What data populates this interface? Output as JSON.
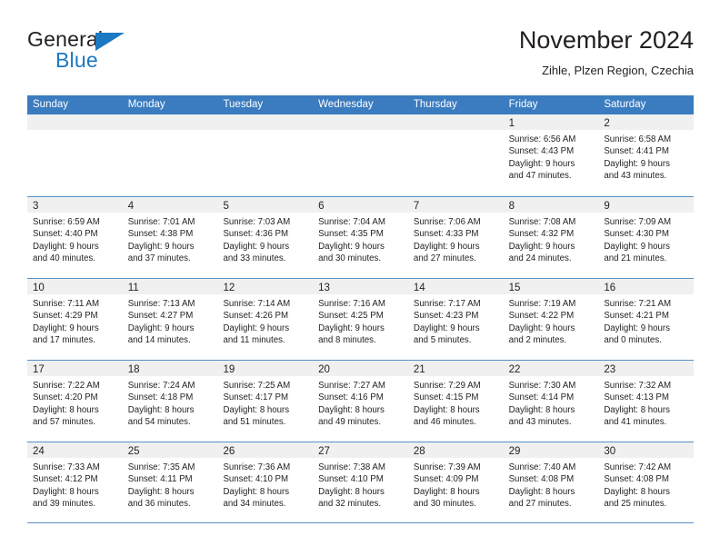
{
  "brand": {
    "name_part1": "General",
    "name_part2": "Blue",
    "flag_icon": "triangle-flag-icon",
    "accent_color": "#1b79c1"
  },
  "header": {
    "title": "November 2024",
    "subtitle": "Zihle, Plzen Region, Czechia"
  },
  "theme": {
    "header_blue": "#3b7cc0",
    "row_line": "#5b90c8",
    "day_band": "#f0f0f0",
    "text": "#231f20"
  },
  "calendar": {
    "weekdays": [
      "Sunday",
      "Monday",
      "Tuesday",
      "Wednesday",
      "Thursday",
      "Friday",
      "Saturday"
    ],
    "weeks": [
      [
        {
          "day": "",
          "empty": true
        },
        {
          "day": "",
          "empty": true
        },
        {
          "day": "",
          "empty": true
        },
        {
          "day": "",
          "empty": true
        },
        {
          "day": "",
          "empty": true
        },
        {
          "day": "1",
          "sunrise": "Sunrise: 6:56 AM",
          "sunset": "Sunset: 4:43 PM",
          "daylight1": "Daylight: 9 hours",
          "daylight2": "and 47 minutes."
        },
        {
          "day": "2",
          "sunrise": "Sunrise: 6:58 AM",
          "sunset": "Sunset: 4:41 PM",
          "daylight1": "Daylight: 9 hours",
          "daylight2": "and 43 minutes."
        }
      ],
      [
        {
          "day": "3",
          "sunrise": "Sunrise: 6:59 AM",
          "sunset": "Sunset: 4:40 PM",
          "daylight1": "Daylight: 9 hours",
          "daylight2": "and 40 minutes."
        },
        {
          "day": "4",
          "sunrise": "Sunrise: 7:01 AM",
          "sunset": "Sunset: 4:38 PM",
          "daylight1": "Daylight: 9 hours",
          "daylight2": "and 37 minutes."
        },
        {
          "day": "5",
          "sunrise": "Sunrise: 7:03 AM",
          "sunset": "Sunset: 4:36 PM",
          "daylight1": "Daylight: 9 hours",
          "daylight2": "and 33 minutes."
        },
        {
          "day": "6",
          "sunrise": "Sunrise: 7:04 AM",
          "sunset": "Sunset: 4:35 PM",
          "daylight1": "Daylight: 9 hours",
          "daylight2": "and 30 minutes."
        },
        {
          "day": "7",
          "sunrise": "Sunrise: 7:06 AM",
          "sunset": "Sunset: 4:33 PM",
          "daylight1": "Daylight: 9 hours",
          "daylight2": "and 27 minutes."
        },
        {
          "day": "8",
          "sunrise": "Sunrise: 7:08 AM",
          "sunset": "Sunset: 4:32 PM",
          "daylight1": "Daylight: 9 hours",
          "daylight2": "and 24 minutes."
        },
        {
          "day": "9",
          "sunrise": "Sunrise: 7:09 AM",
          "sunset": "Sunset: 4:30 PM",
          "daylight1": "Daylight: 9 hours",
          "daylight2": "and 21 minutes."
        }
      ],
      [
        {
          "day": "10",
          "sunrise": "Sunrise: 7:11 AM",
          "sunset": "Sunset: 4:29 PM",
          "daylight1": "Daylight: 9 hours",
          "daylight2": "and 17 minutes."
        },
        {
          "day": "11",
          "sunrise": "Sunrise: 7:13 AM",
          "sunset": "Sunset: 4:27 PM",
          "daylight1": "Daylight: 9 hours",
          "daylight2": "and 14 minutes."
        },
        {
          "day": "12",
          "sunrise": "Sunrise: 7:14 AM",
          "sunset": "Sunset: 4:26 PM",
          "daylight1": "Daylight: 9 hours",
          "daylight2": "and 11 minutes."
        },
        {
          "day": "13",
          "sunrise": "Sunrise: 7:16 AM",
          "sunset": "Sunset: 4:25 PM",
          "daylight1": "Daylight: 9 hours",
          "daylight2": "and 8 minutes."
        },
        {
          "day": "14",
          "sunrise": "Sunrise: 7:17 AM",
          "sunset": "Sunset: 4:23 PM",
          "daylight1": "Daylight: 9 hours",
          "daylight2": "and 5 minutes."
        },
        {
          "day": "15",
          "sunrise": "Sunrise: 7:19 AM",
          "sunset": "Sunset: 4:22 PM",
          "daylight1": "Daylight: 9 hours",
          "daylight2": "and 2 minutes."
        },
        {
          "day": "16",
          "sunrise": "Sunrise: 7:21 AM",
          "sunset": "Sunset: 4:21 PM",
          "daylight1": "Daylight: 9 hours",
          "daylight2": "and 0 minutes."
        }
      ],
      [
        {
          "day": "17",
          "sunrise": "Sunrise: 7:22 AM",
          "sunset": "Sunset: 4:20 PM",
          "daylight1": "Daylight: 8 hours",
          "daylight2": "and 57 minutes."
        },
        {
          "day": "18",
          "sunrise": "Sunrise: 7:24 AM",
          "sunset": "Sunset: 4:18 PM",
          "daylight1": "Daylight: 8 hours",
          "daylight2": "and 54 minutes."
        },
        {
          "day": "19",
          "sunrise": "Sunrise: 7:25 AM",
          "sunset": "Sunset: 4:17 PM",
          "daylight1": "Daylight: 8 hours",
          "daylight2": "and 51 minutes."
        },
        {
          "day": "20",
          "sunrise": "Sunrise: 7:27 AM",
          "sunset": "Sunset: 4:16 PM",
          "daylight1": "Daylight: 8 hours",
          "daylight2": "and 49 minutes."
        },
        {
          "day": "21",
          "sunrise": "Sunrise: 7:29 AM",
          "sunset": "Sunset: 4:15 PM",
          "daylight1": "Daylight: 8 hours",
          "daylight2": "and 46 minutes."
        },
        {
          "day": "22",
          "sunrise": "Sunrise: 7:30 AM",
          "sunset": "Sunset: 4:14 PM",
          "daylight1": "Daylight: 8 hours",
          "daylight2": "and 43 minutes."
        },
        {
          "day": "23",
          "sunrise": "Sunrise: 7:32 AM",
          "sunset": "Sunset: 4:13 PM",
          "daylight1": "Daylight: 8 hours",
          "daylight2": "and 41 minutes."
        }
      ],
      [
        {
          "day": "24",
          "sunrise": "Sunrise: 7:33 AM",
          "sunset": "Sunset: 4:12 PM",
          "daylight1": "Daylight: 8 hours",
          "daylight2": "and 39 minutes."
        },
        {
          "day": "25",
          "sunrise": "Sunrise: 7:35 AM",
          "sunset": "Sunset: 4:11 PM",
          "daylight1": "Daylight: 8 hours",
          "daylight2": "and 36 minutes."
        },
        {
          "day": "26",
          "sunrise": "Sunrise: 7:36 AM",
          "sunset": "Sunset: 4:10 PM",
          "daylight1": "Daylight: 8 hours",
          "daylight2": "and 34 minutes."
        },
        {
          "day": "27",
          "sunrise": "Sunrise: 7:38 AM",
          "sunset": "Sunset: 4:10 PM",
          "daylight1": "Daylight: 8 hours",
          "daylight2": "and 32 minutes."
        },
        {
          "day": "28",
          "sunrise": "Sunrise: 7:39 AM",
          "sunset": "Sunset: 4:09 PM",
          "daylight1": "Daylight: 8 hours",
          "daylight2": "and 30 minutes."
        },
        {
          "day": "29",
          "sunrise": "Sunrise: 7:40 AM",
          "sunset": "Sunset: 4:08 PM",
          "daylight1": "Daylight: 8 hours",
          "daylight2": "and 27 minutes."
        },
        {
          "day": "30",
          "sunrise": "Sunrise: 7:42 AM",
          "sunset": "Sunset: 4:08 PM",
          "daylight1": "Daylight: 8 hours",
          "daylight2": "and 25 minutes."
        }
      ]
    ]
  }
}
